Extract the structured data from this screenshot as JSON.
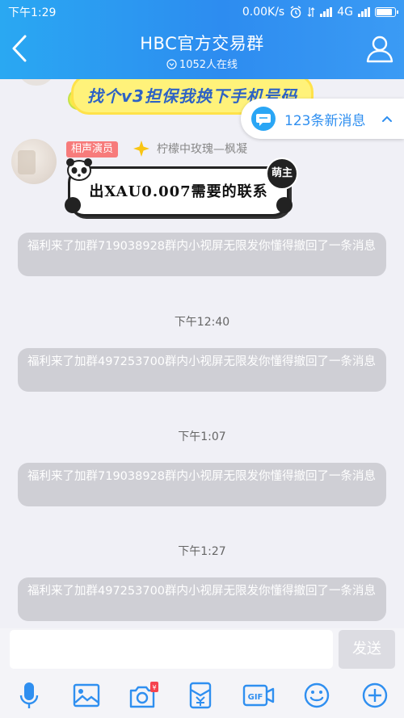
{
  "status": {
    "time": "下午1:29",
    "speed": "0.00K/s",
    "network": "4G"
  },
  "header": {
    "title": "HBC官方交易群",
    "online": "1052人在线"
  },
  "banner": {
    "text": "找个v3担保我换下手机号码"
  },
  "new_messages": {
    "text": "123条新消息"
  },
  "message": {
    "badge": "相声演员",
    "sender": "柠檬中玫瑰—枫凝",
    "sticker_text": "出XAU0.007需要的联系",
    "sticker_tag": "萌主"
  },
  "feed": [
    {
      "type": "system",
      "text": "福利来了加群719038928群内小视屏无限发你懂得撤回了一条消息"
    },
    {
      "type": "time",
      "text": "下午12:40"
    },
    {
      "type": "system",
      "text": "福利来了加群497253700群内小视屏无限发你懂得撤回了一条消息"
    },
    {
      "type": "time",
      "text": "下午1:07"
    },
    {
      "type": "system",
      "text": "福利来了加群719038928群内小视屏无限发你懂得撤回了一条消息"
    },
    {
      "type": "time",
      "text": "下午1:27"
    },
    {
      "type": "system",
      "text": "福利来了加群497253700群内小视屏无限发你懂得撤回了一条消息"
    }
  ],
  "input": {
    "placeholder": "",
    "send_label": "发送"
  },
  "toolbar": {
    "icons": [
      "microphone-icon",
      "image-icon",
      "camera-redpacket-icon",
      "red-envelope-icon",
      "gif-icon",
      "emoji-icon",
      "plus-icon"
    ],
    "redpacket_mark": "¥",
    "gif_label": "GIF"
  },
  "colors": {
    "header": "#2d8cf0",
    "accent": "#2f8ff0",
    "badge": "#f77b7b",
    "system_bubble": "#cfcfd5"
  }
}
